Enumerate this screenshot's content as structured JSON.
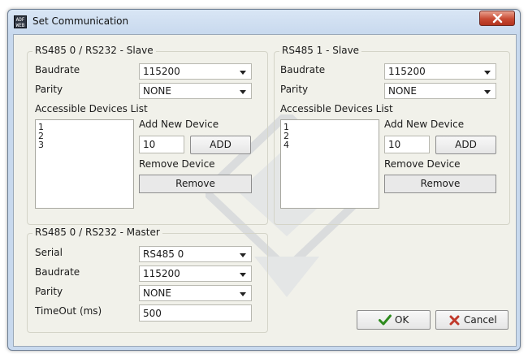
{
  "window": {
    "title": "Set Communication",
    "icon_label": "ADF WEB"
  },
  "slave0": {
    "title": "RS485 0 / RS232 - Slave",
    "baudrate_label": "Baudrate",
    "baudrate_value": "115200",
    "parity_label": "Parity",
    "parity_value": "NONE",
    "devices_label": "Accessible Devices List",
    "devices": [
      "1",
      "2",
      "3"
    ],
    "add_label": "Add New Device",
    "add_value": "10",
    "add_button": "ADD",
    "remove_label": "Remove Device",
    "remove_button": "Remove"
  },
  "slave1": {
    "title": "RS485 1 - Slave",
    "baudrate_label": "Baudrate",
    "baudrate_value": "115200",
    "parity_label": "Parity",
    "parity_value": "NONE",
    "devices_label": "Accessible Devices List",
    "devices": [
      "1",
      "2",
      "4"
    ],
    "add_label": "Add New Device",
    "add_value": "10",
    "add_button": "ADD",
    "remove_label": "Remove Device",
    "remove_button": "Remove"
  },
  "master": {
    "title": "RS485 0 / RS232 - Master",
    "serial_label": "Serial",
    "serial_value": "RS485 0",
    "baudrate_label": "Baudrate",
    "baudrate_value": "115200",
    "parity_label": "Parity",
    "parity_value": "NONE",
    "timeout_label": "TimeOut (ms)",
    "timeout_value": "500"
  },
  "footer": {
    "ok_label": "OK",
    "cancel_label": "Cancel"
  },
  "colors": {
    "ok_icon": "#2e8b1e",
    "cancel_icon": "#c0392b",
    "close_button": "#c84a33"
  },
  "icons": {
    "app": "app-icon",
    "close": "close-icon",
    "ok": "checkmark-icon",
    "cancel": "x-icon",
    "dropdown": "chevron-down-icon"
  }
}
